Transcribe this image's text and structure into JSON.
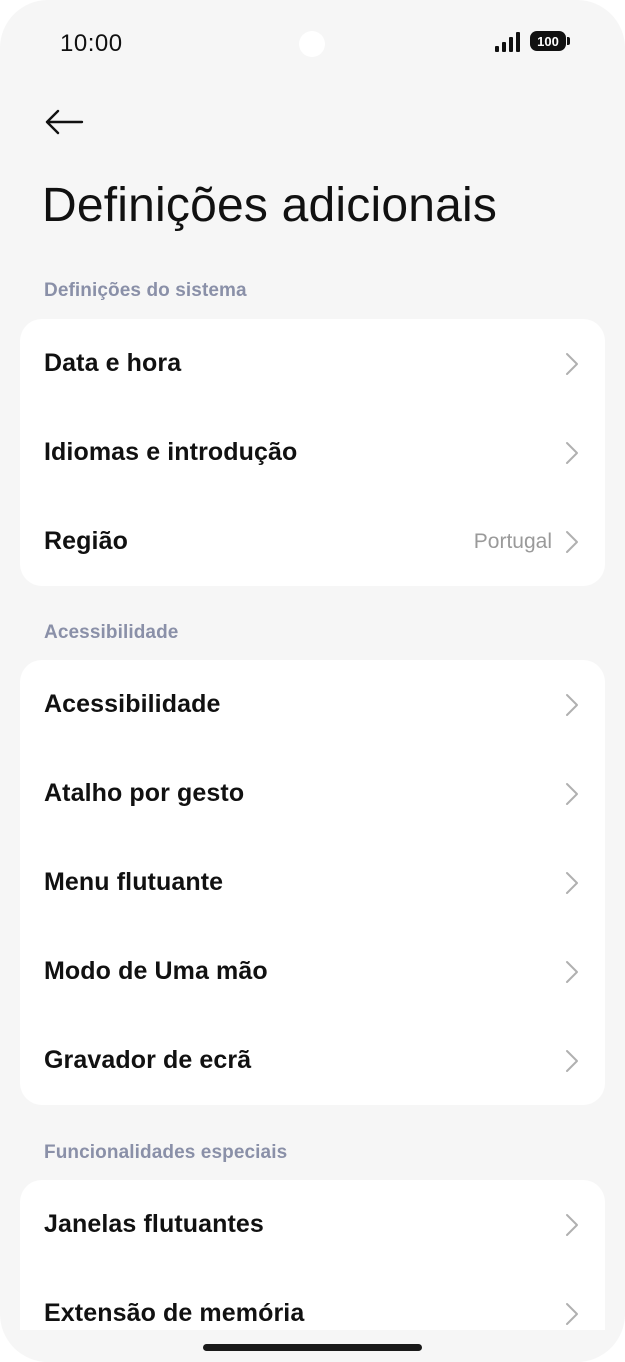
{
  "status_bar": {
    "time": "10:00",
    "battery": "100"
  },
  "page": {
    "title": "Definições adicionais"
  },
  "sections": [
    {
      "header": "Definições do sistema",
      "items": [
        {
          "label": "Data e hora",
          "value": ""
        },
        {
          "label": "Idiomas e introdução",
          "value": ""
        },
        {
          "label": "Região",
          "value": "Portugal"
        }
      ]
    },
    {
      "header": "Acessibilidade",
      "items": [
        {
          "label": "Acessibilidade",
          "value": ""
        },
        {
          "label": "Atalho por gesto",
          "value": ""
        },
        {
          "label": "Menu flutuante",
          "value": ""
        },
        {
          "label": "Modo de Uma mão",
          "value": ""
        },
        {
          "label": "Gravador de ecrã",
          "value": ""
        }
      ]
    },
    {
      "header": "Funcionalidades especiais",
      "items": [
        {
          "label": "Janelas flutuantes",
          "value": ""
        },
        {
          "label": "Extensão de memória",
          "value": ""
        }
      ]
    }
  ],
  "icons": {
    "back": "arrow-left-icon",
    "row": "chevron-right-icon",
    "signal": "signal-icon",
    "battery": "battery-icon"
  },
  "colors": {
    "background": "#f6f6f6",
    "card": "#ffffff",
    "section_header": "#8a90a8",
    "text": "#111111",
    "secondary": "#9a9a9a",
    "chevron": "#b0b0b0"
  }
}
